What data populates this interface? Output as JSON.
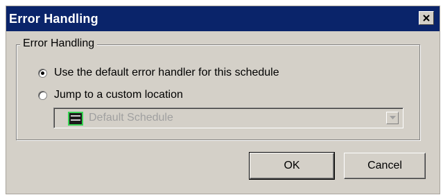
{
  "window": {
    "title": "Error Handling"
  },
  "group": {
    "legend": "Error Handling",
    "options": [
      {
        "label": "Use the default error handler for this schedule",
        "selected": true
      },
      {
        "label": "Jump to a custom location",
        "selected": false
      }
    ],
    "location_select": {
      "value": "Default Schedule",
      "disabled": true,
      "icon": "schedule-icon"
    }
  },
  "buttons": {
    "ok_label": "OK",
    "cancel_label": "Cancel"
  },
  "colors": {
    "titlebar": "#0a246a",
    "dialog_bg": "#d4d0c8",
    "disabled_text": "#a0a0a0",
    "icon_accent": "#39d353"
  }
}
